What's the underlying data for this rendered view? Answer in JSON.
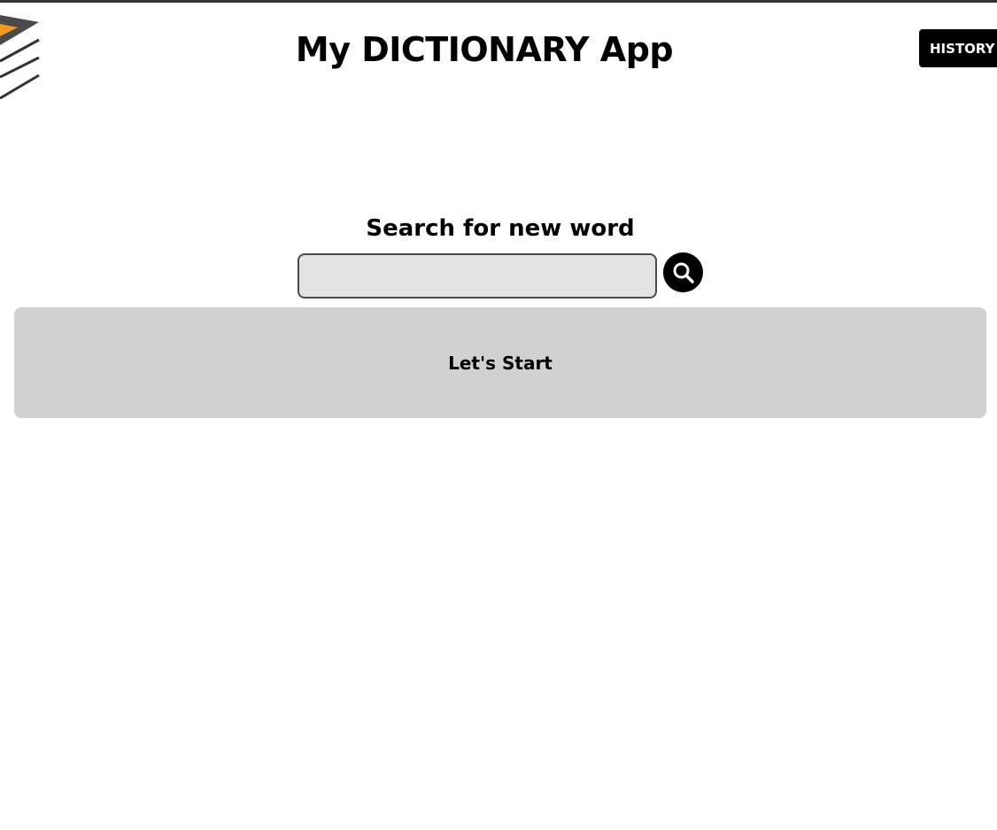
{
  "header": {
    "title": "My DICTIONARY App",
    "history_label": "HISTORY",
    "logo_icon": "book-stack-icon",
    "accent_color": "#f39a1e"
  },
  "search": {
    "heading": "Search for new word",
    "value": "",
    "placeholder": "",
    "button_icon": "search-icon"
  },
  "result": {
    "message": "Let's Start"
  }
}
